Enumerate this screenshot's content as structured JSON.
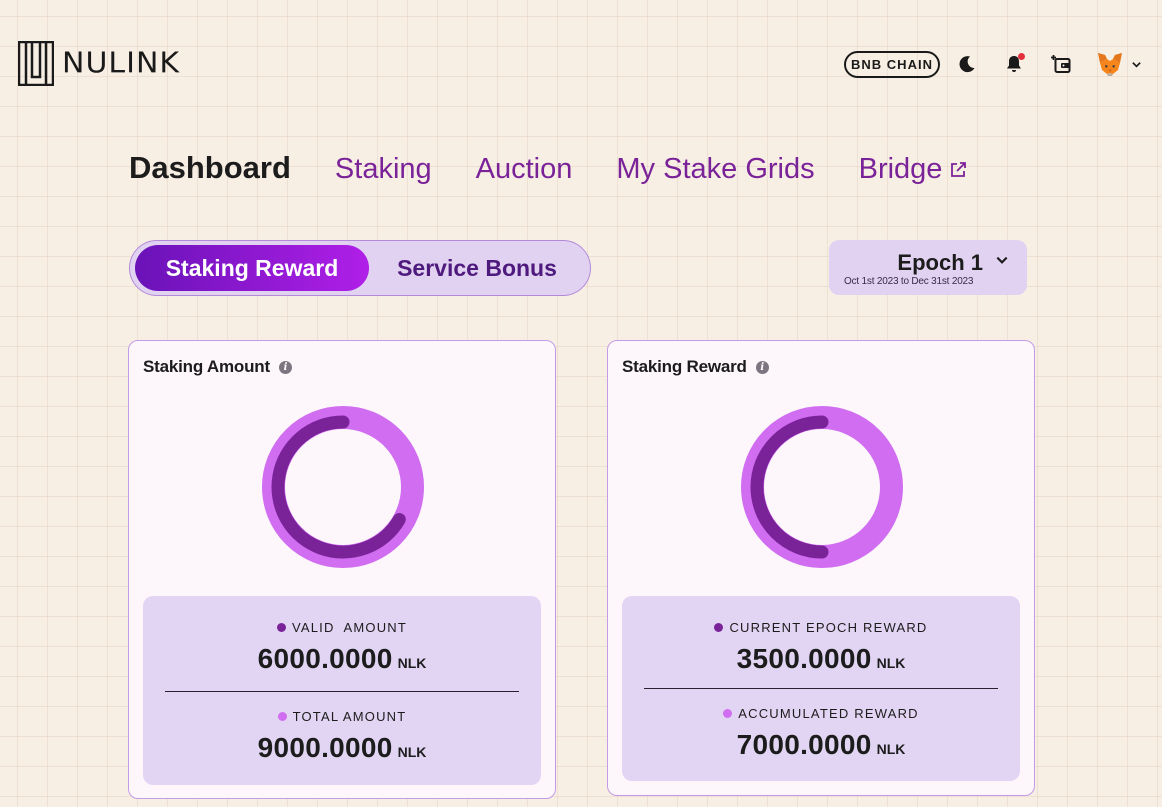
{
  "brand": {
    "name": "NULINK"
  },
  "header": {
    "chain_label": "BNB CHAIN",
    "icons": [
      "moon-icon",
      "bell-icon",
      "wallet-icon",
      "metamask-fox-icon",
      "chevron-down-icon"
    ]
  },
  "nav": {
    "items": [
      {
        "label": "Dashboard",
        "active": true
      },
      {
        "label": "Staking"
      },
      {
        "label": "Auction"
      },
      {
        "label": "My Stake Grids"
      },
      {
        "label": "Bridge",
        "external": true
      }
    ]
  },
  "toggle": {
    "active": "Staking Reward",
    "inactive": "Service Bonus"
  },
  "epoch": {
    "title": "Epoch 1",
    "range": "Oct 1st 2023 to Dec 31st 2023"
  },
  "colors": {
    "dark": "#7a2399",
    "light": "#d06df0",
    "accent": "#9a1fd6",
    "panel": "#e2d5f3"
  },
  "cards": {
    "staking_amount": {
      "title": "Staking Amount",
      "primary": {
        "label": "VALID  AMOUNT",
        "value": "6000.0000",
        "unit": "NLK"
      },
      "secondary": {
        "label": "TOTAL AMOUNT",
        "value": "9000.0000",
        "unit": "NLK"
      },
      "ratio": 0.6667
    },
    "staking_reward": {
      "title": "Staking Reward",
      "primary": {
        "label": "CURRENT EPOCH REWARD",
        "value": "3500.0000",
        "unit": "NLK"
      },
      "secondary": {
        "label": "ACCUMULATED REWARD",
        "value": "7000.0000",
        "unit": "NLK"
      },
      "ratio": 0.5
    }
  }
}
